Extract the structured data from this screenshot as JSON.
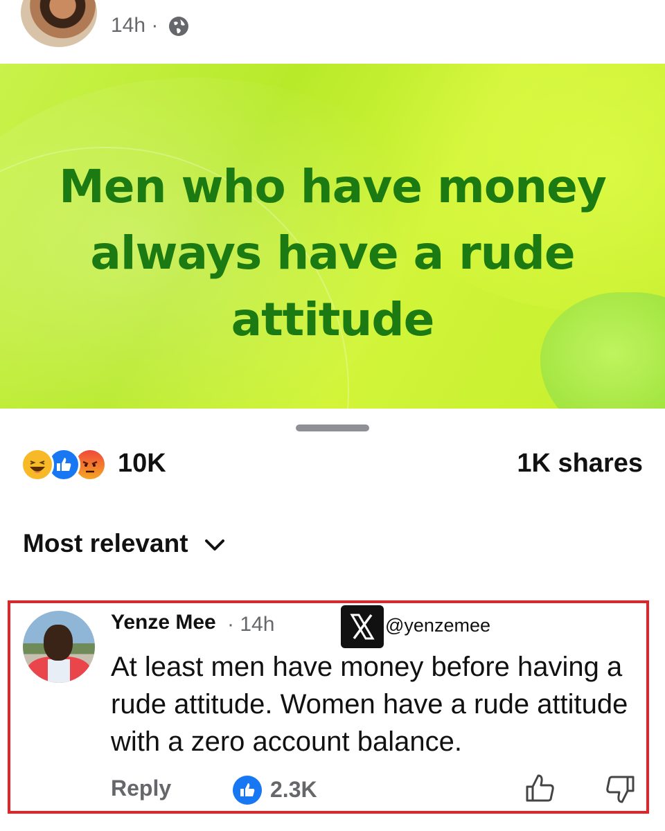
{
  "post": {
    "time": "14h",
    "separator": "·",
    "text": "Men who have money always have a rude attitude"
  },
  "stats": {
    "reactions_count": "10K",
    "shares": "1K shares",
    "reaction_types": [
      "haha",
      "like",
      "angry"
    ]
  },
  "sort": {
    "label": "Most relevant"
  },
  "comment": {
    "author": "Yenze Mee",
    "time": "· 14h",
    "watermark_handle": "@yenzemee",
    "text": "At least men have money before having a rude attitude. Women have a rude attitude with a zero account balance.",
    "reply_label": "Reply",
    "like_count": "2.3K",
    "highlight_color": "#e32327"
  },
  "colors": {
    "post_text": "#1c7a12",
    "background_accent": "#c4ee2c",
    "like_blue": "#1877f2",
    "meta_gray": "#65676b"
  }
}
